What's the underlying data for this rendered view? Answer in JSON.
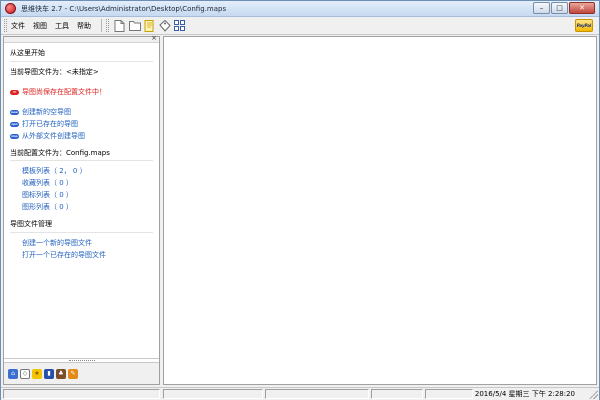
{
  "window": {
    "title": "思维快车 2.7 - C:\\Users\\Administrator\\Desktop\\Config.maps",
    "minimize_glyph": "–",
    "maximize_glyph": "□",
    "close_glyph": "✕"
  },
  "menu": {
    "items": [
      "文件",
      "视图",
      "工具",
      "帮助"
    ]
  },
  "toolbar": {
    "buttons": [
      "new-file-icon",
      "open-folder-icon",
      "edit-note-icon",
      "tag-icon",
      "layout-icon"
    ],
    "paypal_label": "PayPal"
  },
  "left_panel": {
    "close_glyph": "×",
    "start_title": "从这里开始",
    "current_file": "当前导图文件为：<未指定>",
    "warning": "导图尚保存在配置文件中！",
    "actions": [
      "创建新的空导图",
      "打开已存在的导图",
      "从外部文件创建导图"
    ],
    "config_file": "当前配置文件为：Config.maps",
    "config_items": [
      "模板列表（ 2， 0 ）",
      "收藏列表（ 0 ）",
      "图标列表（ 0 ）",
      "图形列表（ 0 ）"
    ],
    "file_mgmt_title": "导图文件管理",
    "file_mgmt_items": [
      "创建一个新的导图文件",
      "打开一个已存在的导图文件"
    ]
  },
  "statusbar": {
    "datetime": "2016/5/4 星期三 下午 2:28:20"
  },
  "colors": {
    "link": "#1f5fbf",
    "warning": "#e02020",
    "frame": "#6d8fb5"
  }
}
